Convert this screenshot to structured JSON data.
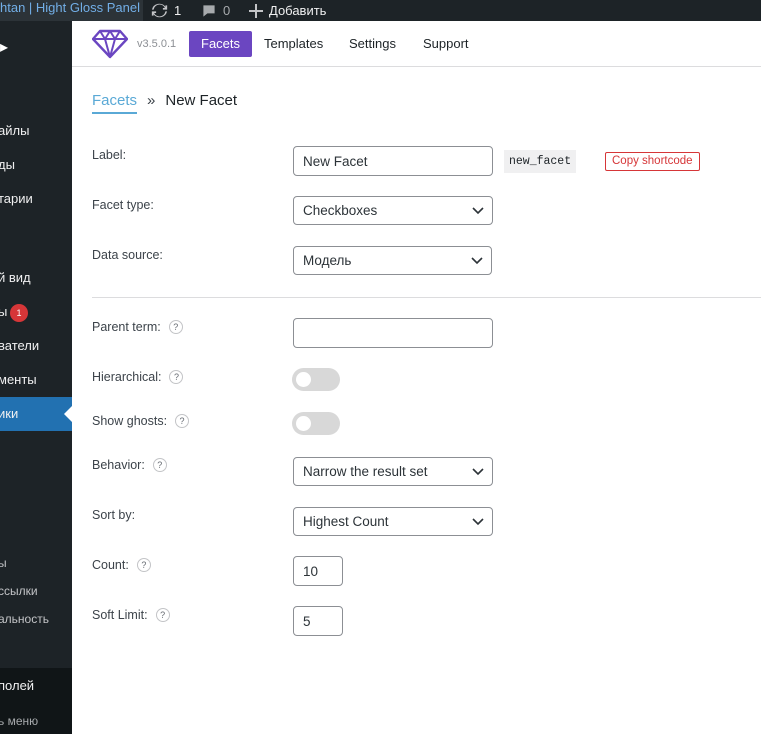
{
  "adminbar": {
    "site_name": "htan | Hight Gloss Panel",
    "updates_count": "1",
    "comments_count": "0",
    "add_label": "Добавить"
  },
  "sidebar": {
    "items": [
      {
        "label": "айлы"
      },
      {
        "label": "ды"
      },
      {
        "label": "тарии"
      },
      {
        "label": "й вид"
      },
      {
        "label": "ы",
        "badge": "1"
      },
      {
        "label": "ватели"
      },
      {
        "label": "менты"
      },
      {
        "label": "ики"
      }
    ],
    "sub_items": [
      {
        "label": "ы"
      },
      {
        "label": "ссылки"
      },
      {
        "label": "альность"
      }
    ],
    "bottom_items": [
      {
        "label": "полей"
      },
      {
        "label": "ь меню"
      }
    ]
  },
  "plugin": {
    "version": "v3.5.0.1",
    "tabs": [
      {
        "label": "Facets",
        "active": true
      },
      {
        "label": "Templates"
      },
      {
        "label": "Settings"
      },
      {
        "label": "Support"
      }
    ],
    "logo_color": "#6b46c1"
  },
  "breadcrumb": {
    "parent": "Facets",
    "separator": "»",
    "current": "New Facet"
  },
  "form": {
    "label": {
      "label": "Label:",
      "value": "New Facet",
      "name": "new_facet",
      "copy_label": "Copy shortcode"
    },
    "facet_type": {
      "label": "Facet type:",
      "value": "Checkboxes"
    },
    "data_source": {
      "label": "Data source:",
      "value": "Модель"
    },
    "parent_term": {
      "label": "Parent term:",
      "value": ""
    },
    "hierarchical": {
      "label": "Hierarchical:",
      "on": false
    },
    "show_ghosts": {
      "label": "Show ghosts:",
      "on": false
    },
    "behavior": {
      "label": "Behavior:",
      "value": "Narrow the result set"
    },
    "sort_by": {
      "label": "Sort by:",
      "value": "Highest Count"
    },
    "count": {
      "label": "Count:",
      "value": "10"
    },
    "soft_limit": {
      "label": "Soft Limit:",
      "value": "5"
    },
    "help_glyph": "?"
  },
  "colors": {
    "accent": "#6b46c1",
    "link": "#5aa9d6",
    "danger": "#d63638",
    "sidebar": "#1d2327",
    "sidebar_active": "#2271b1"
  }
}
